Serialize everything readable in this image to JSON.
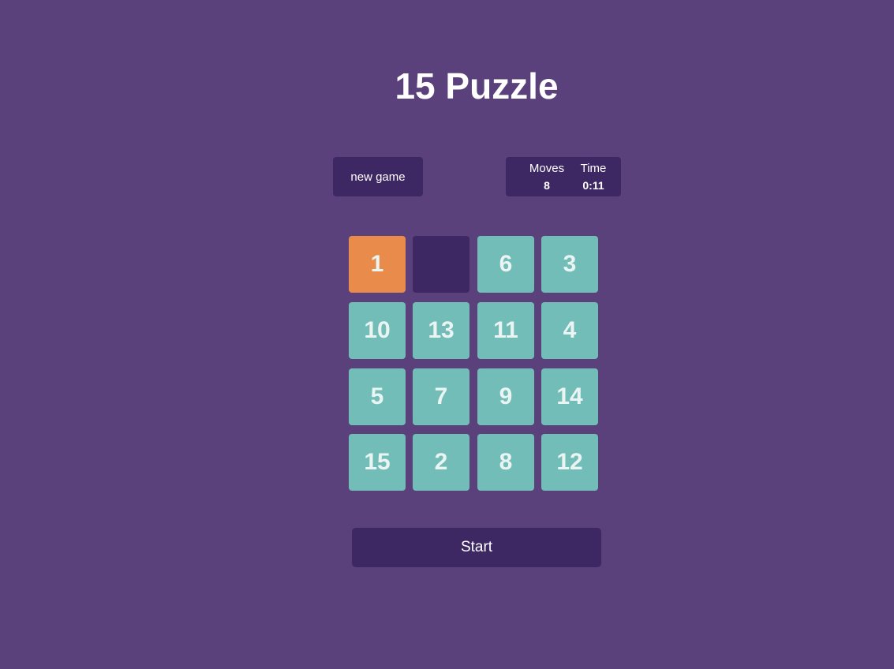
{
  "title": "15 Puzzle",
  "controls": {
    "new_game_label": "new game",
    "start_label": "Start"
  },
  "stats": {
    "moves_label": "Moves",
    "moves_value": "8",
    "time_label": "Time",
    "time_value": "0:11"
  },
  "board": {
    "rows": [
      [
        "1",
        "",
        "6",
        "3"
      ],
      [
        "10",
        "13",
        "11",
        "4"
      ],
      [
        "5",
        "7",
        "9",
        "14"
      ],
      [
        "15",
        "2",
        "8",
        "12"
      ]
    ],
    "highlighted_tile": "1"
  },
  "colors": {
    "background": "#5a417c",
    "panel": "#3e2863",
    "tile": "#72bdb7",
    "tile_highlight": "#e98b4b",
    "empty_cell": "#3e2863"
  }
}
